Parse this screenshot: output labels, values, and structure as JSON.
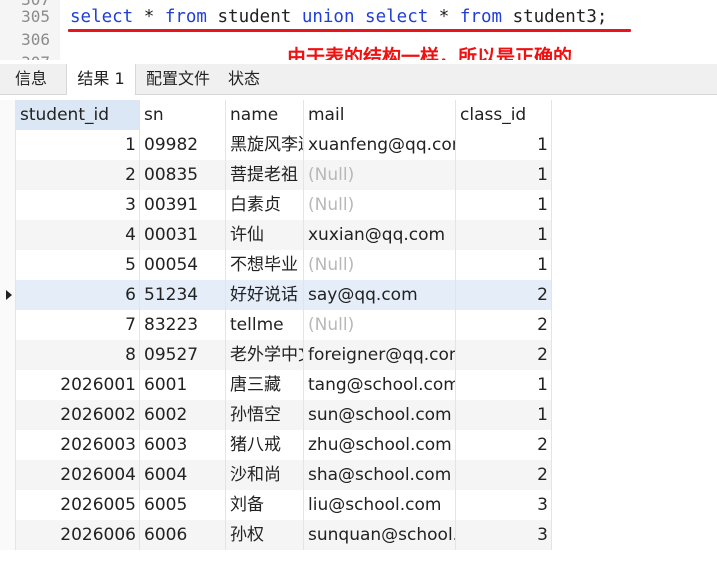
{
  "editor": {
    "line_numbers": [
      "307",
      "305",
      "306",
      "307"
    ],
    "code_parts": [
      {
        "text": "select",
        "kw": true
      },
      {
        "text": " * ",
        "kw": false
      },
      {
        "text": "from",
        "kw": true
      },
      {
        "text": " student ",
        "kw": false
      },
      {
        "text": "union",
        "kw": true
      },
      {
        "text": " ",
        "kw": false
      },
      {
        "text": "select",
        "kw": true
      },
      {
        "text": " * ",
        "kw": false
      },
      {
        "text": "from",
        "kw": true
      },
      {
        "text": " student3;",
        "kw": false
      }
    ],
    "annotation": "由于表的结构一样，所以是正确的",
    "colors": {
      "keyword": "#1f3fd6",
      "annotation": "#f01010"
    }
  },
  "tabs": [
    {
      "label": "信息",
      "active": false
    },
    {
      "label": "结果 1",
      "active": true
    },
    {
      "label": "配置文件",
      "active": false
    },
    {
      "label": "状态",
      "active": false
    }
  ],
  "grid": {
    "columns": [
      "student_id",
      "sn",
      "name",
      "mail",
      "class_id"
    ],
    "rows": [
      {
        "student_id": "1",
        "sn": "09982",
        "name": "黑旋风李逵",
        "mail": "xuanfeng@qq.com",
        "class_id": "1"
      },
      {
        "student_id": "2",
        "sn": "00835",
        "name": "菩提老祖",
        "mail": "(Null)",
        "class_id": "1"
      },
      {
        "student_id": "3",
        "sn": "00391",
        "name": "白素贞",
        "mail": "(Null)",
        "class_id": "1"
      },
      {
        "student_id": "4",
        "sn": "00031",
        "name": "许仙",
        "mail": "xuxian@qq.com",
        "class_id": "1"
      },
      {
        "student_id": "5",
        "sn": "00054",
        "name": "不想毕业",
        "mail": "(Null)",
        "class_id": "1"
      },
      {
        "student_id": "6",
        "sn": "51234",
        "name": "好好说话",
        "mail": "say@qq.com",
        "class_id": "2",
        "current": true
      },
      {
        "student_id": "7",
        "sn": "83223",
        "name": "tellme",
        "mail": "(Null)",
        "class_id": "2"
      },
      {
        "student_id": "8",
        "sn": "09527",
        "name": "老外学中文",
        "mail": "foreigner@qq.com",
        "class_id": "2"
      },
      {
        "student_id": "2026001",
        "sn": "6001",
        "name": "唐三藏",
        "mail": "tang@school.com",
        "class_id": "1"
      },
      {
        "student_id": "2026002",
        "sn": "6002",
        "name": "孙悟空",
        "mail": "sun@school.com",
        "class_id": "1"
      },
      {
        "student_id": "2026003",
        "sn": "6003",
        "name": "猪八戒",
        "mail": "zhu@school.com",
        "class_id": "2"
      },
      {
        "student_id": "2026004",
        "sn": "6004",
        "name": "沙和尚",
        "mail": "sha@school.com",
        "class_id": "2"
      },
      {
        "student_id": "2026005",
        "sn": "6005",
        "name": "刘备",
        "mail": "liu@school.com",
        "class_id": "3"
      },
      {
        "student_id": "2026006",
        "sn": "6006",
        "name": "孙权",
        "mail": "sunquan@school.com",
        "class_id": "3"
      }
    ]
  }
}
